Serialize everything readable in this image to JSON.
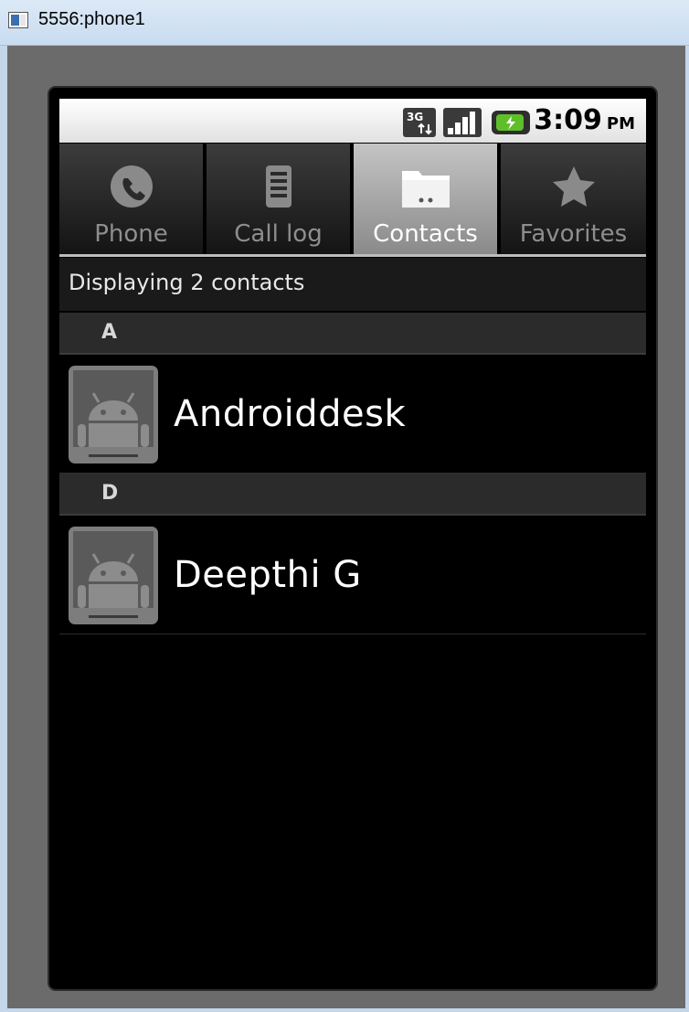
{
  "window": {
    "title": "5556:phone1"
  },
  "status_bar": {
    "time": "3:09",
    "ampm": "PM",
    "network": "3G"
  },
  "tabs": [
    {
      "label": "Phone",
      "icon": "phone-icon",
      "selected": false
    },
    {
      "label": "Call log",
      "icon": "call-log-icon",
      "selected": false
    },
    {
      "label": "Contacts",
      "icon": "contacts-folder-icon",
      "selected": true
    },
    {
      "label": "Favorites",
      "icon": "star-icon",
      "selected": false
    }
  ],
  "contacts": {
    "summary": "Displaying 2 contacts",
    "sections": [
      {
        "letter": "A",
        "entries": [
          {
            "name": "Androiddesk"
          }
        ]
      },
      {
        "letter": "D",
        "entries": [
          {
            "name": "Deepthi G"
          }
        ]
      }
    ]
  },
  "colors": {
    "selected_tab": "#a9a9a9",
    "screen_bg": "#000000",
    "title_bar": "#d3e3f4"
  }
}
